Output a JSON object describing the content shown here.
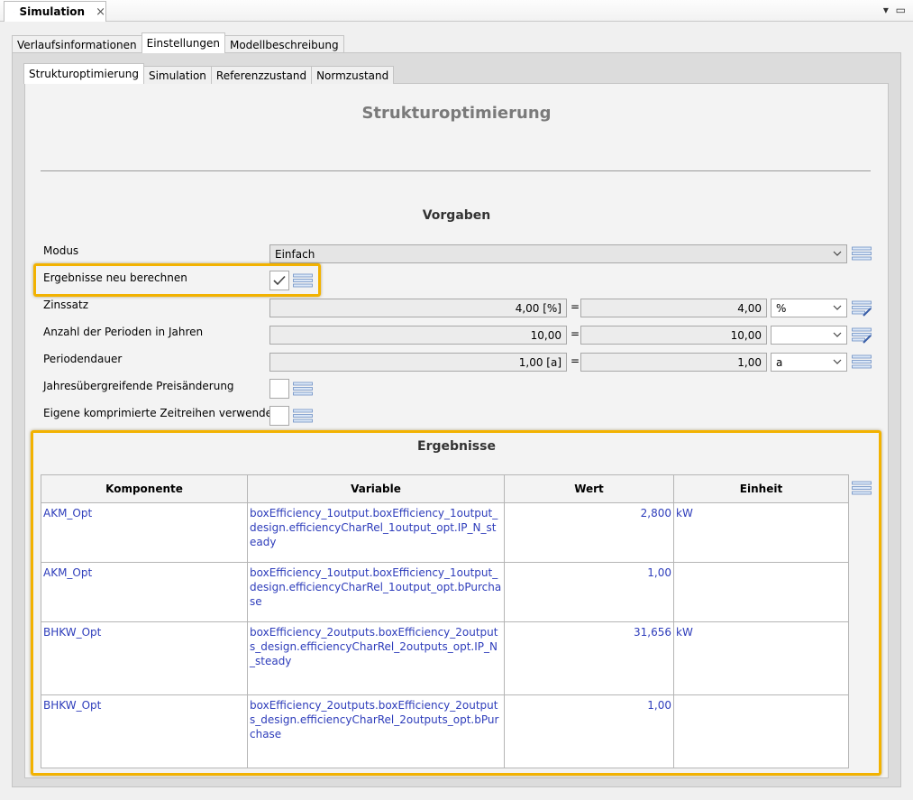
{
  "view": {
    "title": "Simulation",
    "close": "×",
    "controls": "▾ ▭"
  },
  "top_tabs": [
    "Verlaufsinformationen",
    "Einstellungen",
    "Modellbeschreibung"
  ],
  "sub_tabs": [
    "Strukturoptimierung",
    "Simulation",
    "Referenzzustand",
    "Normzustand"
  ],
  "page_title": "Strukturoptimierung",
  "vorgaben": {
    "title": "Vorgaben",
    "modus": {
      "label": "Modus",
      "value": "Einfach"
    },
    "neu_berechnen": {
      "label": "Ergebnisse neu berechnen",
      "checked": true
    },
    "zinssatz": {
      "label": "Zinssatz",
      "value": "4,00 [%]",
      "converted": "4,00",
      "unit": "%"
    },
    "perioden": {
      "label": "Anzahl der Perioden in Jahren",
      "value": "10,00",
      "converted": "10,00",
      "unit": ""
    },
    "periodendauer": {
      "label": "Periodendauer",
      "value": "1,00 [a]",
      "converted": "1,00",
      "unit": "a"
    },
    "preisaenderung": {
      "label": "Jahresübergreifende Preisänderung",
      "checked": false
    },
    "zeitreihen": {
      "label": "Eigene komprimierte Zeitreihen verwenden",
      "checked": false
    },
    "equals": "="
  },
  "ergebnisse": {
    "title": "Ergebnisse",
    "columns": [
      "Komponente",
      "Variable",
      "Wert",
      "Einheit"
    ],
    "rows": [
      {
        "komponente": "AKM_Opt",
        "variable": "boxEfficiency_1output.boxEfficiency_1output_design.efficiencyCharRel_1output_opt.IP_N_steady",
        "wert": "2,800",
        "einheit": "kW"
      },
      {
        "komponente": "AKM_Opt",
        "variable": "boxEfficiency_1output.boxEfficiency_1output_design.efficiencyCharRel_1output_opt.bPurchase",
        "wert": "1,00",
        "einheit": ""
      },
      {
        "komponente": "BHKW_Opt",
        "variable": "boxEfficiency_2outputs.boxEfficiency_2outputs_design.efficiencyCharRel_2outputs_opt.IP_N_steady",
        "wert": "31,656",
        "einheit": "kW"
      },
      {
        "komponente": "BHKW_Opt",
        "variable": "boxEfficiency_2outputs.boxEfficiency_2outputs_design.efficiencyCharRel_2outputs_opt.bPurchase",
        "wert": "1,00",
        "einheit": ""
      }
    ]
  },
  "colors": {
    "highlight": "#f2b200",
    "link_text": "#2e3dbb",
    "heading_gray": "#7a7a7a"
  }
}
